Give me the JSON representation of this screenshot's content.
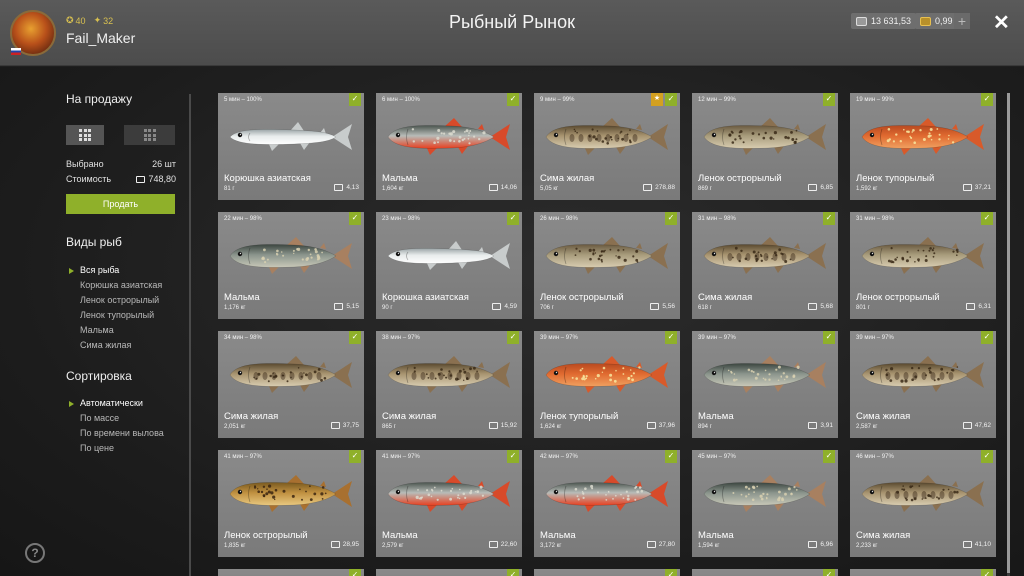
{
  "header": {
    "title": "Рыбный Рынок",
    "username": "Fail_Maker",
    "level1": "40",
    "level2": "32",
    "silver": "13 631,53",
    "gold": "0,99",
    "plus": "+",
    "close": "✕"
  },
  "sidebar": {
    "for_sale_title": "На продажу",
    "selected_label": "Выбрано",
    "selected_value": "26 шт",
    "cost_label": "Стоимость",
    "cost_value": "748,80",
    "sell_button": "Продать",
    "species_title": "Виды рыб",
    "species": [
      "Вся рыба",
      "Корюшка азиатская",
      "Ленок острорылый",
      "Ленок тупорылый",
      "Мальма",
      "Сима жилая"
    ],
    "sort_title": "Сортировка",
    "sort_options": [
      "Автоматически",
      "По массе",
      "По времени вылова",
      "По цене"
    ],
    "help": "?"
  },
  "colors": {
    "accent": "#8fb02a",
    "bookmark": "#d4a020"
  },
  "cards": [
    {
      "time": "5 мин – 100%",
      "name": "Корюшка азиатская",
      "weight": "81 г",
      "price": "4,13",
      "fish": "smelt",
      "bookmark": false
    },
    {
      "time": "6 мин – 100%",
      "name": "Мальма",
      "weight": "1,604 кг",
      "price": "14,06",
      "fish": "malma",
      "bookmark": false
    },
    {
      "time": "9 мин – 99%",
      "name": "Сима жилая",
      "weight": "5,05 кг",
      "price": "278,88",
      "fish": "sima",
      "bookmark": true
    },
    {
      "time": "12 мин – 99%",
      "name": "Ленок острорылый",
      "weight": "869 г",
      "price": "6,85",
      "fish": "lenok",
      "bookmark": false
    },
    {
      "time": "19 мин – 99%",
      "name": "Ленок тупорылый",
      "weight": "1,592 кг",
      "price": "37,21",
      "fish": "lenok_red",
      "bookmark": false
    },
    {
      "time": "22 мин – 98%",
      "name": "Мальма",
      "weight": "1,176 кг",
      "price": "5,15",
      "fish": "malma_dark",
      "bookmark": false
    },
    {
      "time": "23 мин – 98%",
      "name": "Корюшка азиатская",
      "weight": "90 г",
      "price": "4,59",
      "fish": "smelt",
      "bookmark": false
    },
    {
      "time": "26 мин – 98%",
      "name": "Ленок острорылый",
      "weight": "706 г",
      "price": "5,56",
      "fish": "lenok",
      "bookmark": false
    },
    {
      "time": "31 мин – 98%",
      "name": "Сима жилая",
      "weight": "618 г",
      "price": "5,68",
      "fish": "sima",
      "bookmark": false
    },
    {
      "time": "31 мин – 98%",
      "name": "Ленок острорылый",
      "weight": "801 г",
      "price": "6,31",
      "fish": "lenok",
      "bookmark": false
    },
    {
      "time": "34 мин – 98%",
      "name": "Сима жилая",
      "weight": "2,051 кг",
      "price": "37,75",
      "fish": "sima",
      "bookmark": false
    },
    {
      "time": "38 мин – 97%",
      "name": "Сима жилая",
      "weight": "865 г",
      "price": "15,92",
      "fish": "sima",
      "bookmark": false
    },
    {
      "time": "39 мин – 97%",
      "name": "Ленок тупорылый",
      "weight": "1,624 кг",
      "price": "37,96",
      "fish": "lenok_red",
      "bookmark": false
    },
    {
      "time": "39 мин – 97%",
      "name": "Мальма",
      "weight": "894 г",
      "price": "3,91",
      "fish": "malma_dark",
      "bookmark": false
    },
    {
      "time": "39 мин – 97%",
      "name": "Сима жилая",
      "weight": "2,587 кг",
      "price": "47,62",
      "fish": "sima",
      "bookmark": false
    },
    {
      "time": "41 мин – 97%",
      "name": "Ленок острорылый",
      "weight": "1,835 кг",
      "price": "28,95",
      "fish": "lenok_gold",
      "bookmark": false
    },
    {
      "time": "41 мин – 97%",
      "name": "Мальма",
      "weight": "2,579 кг",
      "price": "22,60",
      "fish": "malma",
      "bookmark": false
    },
    {
      "time": "42 мин – 97%",
      "name": "Мальма",
      "weight": "3,172 кг",
      "price": "27,80",
      "fish": "malma",
      "bookmark": false
    },
    {
      "time": "45 мин – 97%",
      "name": "Мальма",
      "weight": "1,594 кг",
      "price": "6,96",
      "fish": "malma_dark",
      "bookmark": false
    },
    {
      "time": "46 мин – 97%",
      "name": "Сима жилая",
      "weight": "2,233 кг",
      "price": "41,10",
      "fish": "sima",
      "bookmark": false
    }
  ],
  "check_glyph": "✓",
  "bookmark_glyph": "★"
}
